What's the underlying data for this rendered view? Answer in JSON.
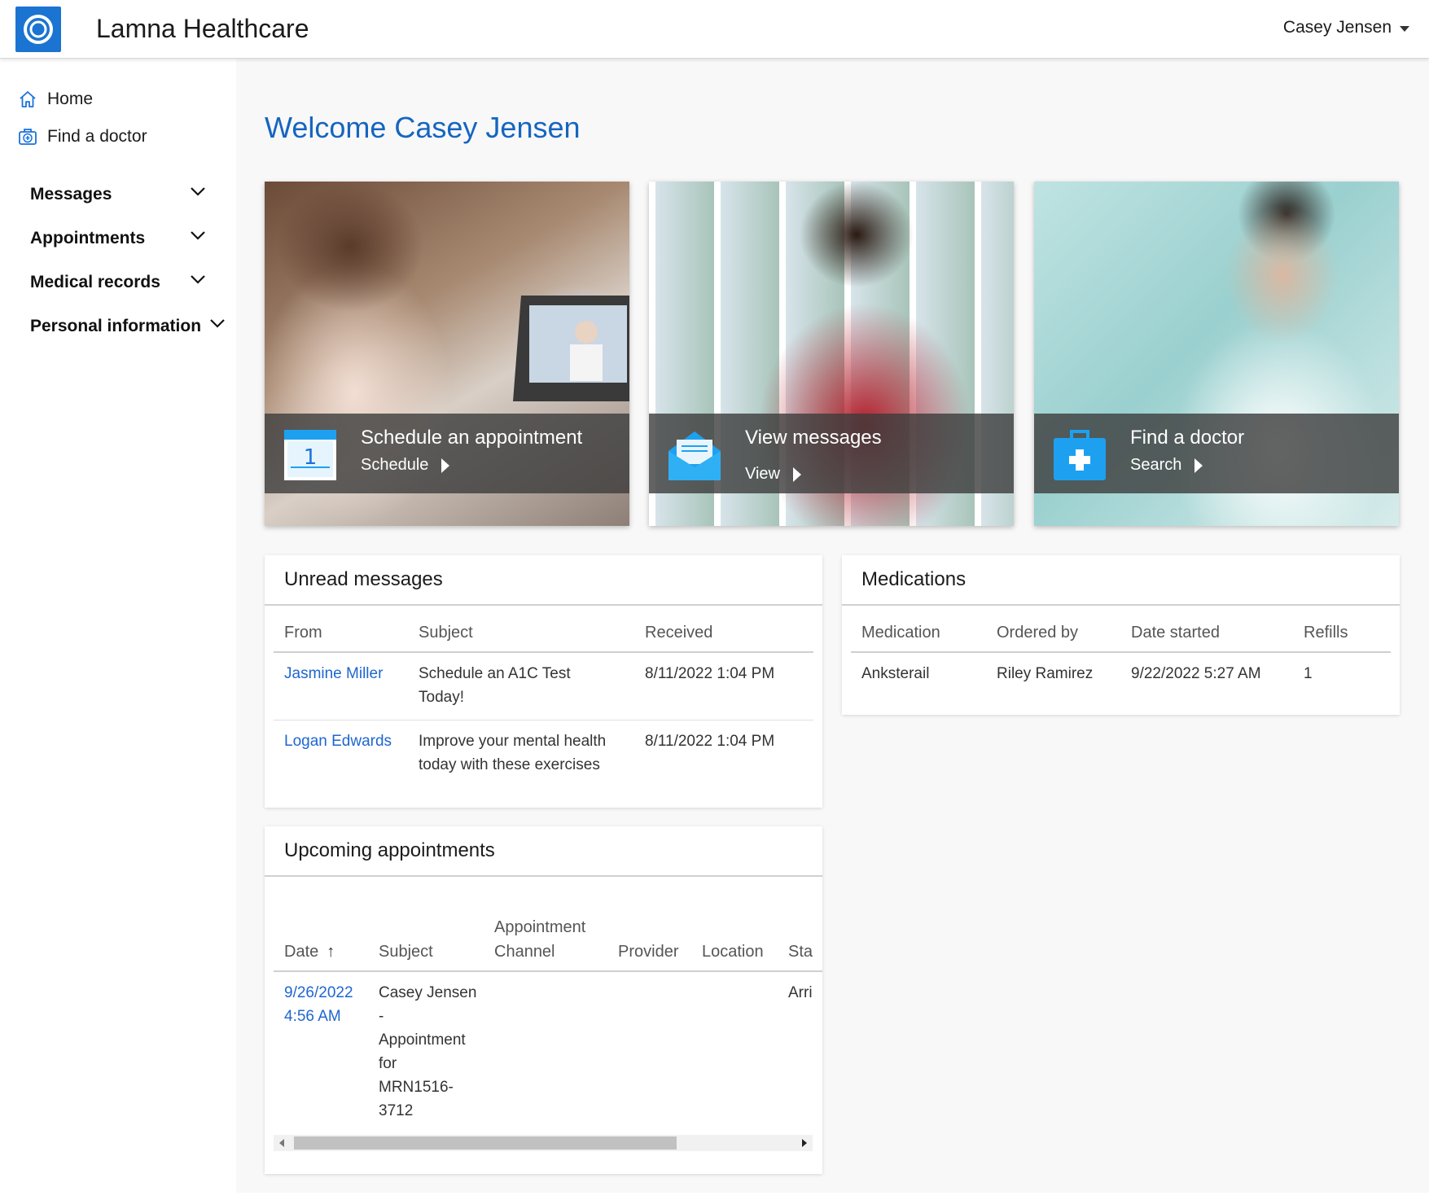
{
  "header": {
    "app_name": "Lamna Healthcare",
    "user_name": "Casey Jensen"
  },
  "sidebar": {
    "links": [
      {
        "label": "Home",
        "icon": "home-icon"
      },
      {
        "label": "Find a doctor",
        "icon": "medical-kit-icon"
      }
    ],
    "groups": [
      {
        "label": "Messages"
      },
      {
        "label": "Appointments"
      },
      {
        "label": "Medical records"
      },
      {
        "label": "Personal information"
      }
    ]
  },
  "main": {
    "welcome": "Welcome Casey Jensen",
    "tiles": [
      {
        "title": "Schedule an appointment",
        "link": "Schedule",
        "icon": "calendar-icon"
      },
      {
        "title": "View messages",
        "link": "View",
        "icon": "envelope-icon"
      },
      {
        "title": "Find a doctor",
        "link": "Search",
        "icon": "medical-kit-icon"
      }
    ]
  },
  "unread_messages": {
    "title": "Unread messages",
    "columns": [
      "From",
      "Subject",
      "Received"
    ],
    "rows": [
      {
        "from": "Jasmine Miller",
        "subject_line1": "Schedule an A1C Test",
        "subject_line2": "Today!",
        "received": "8/11/2022 1:04 PM"
      },
      {
        "from": "Logan Edwards",
        "subject_line1": "Improve your mental health",
        "subject_line2": "today with these exercises",
        "received": "8/11/2022 1:04 PM"
      }
    ]
  },
  "medications": {
    "title": "Medications",
    "columns": [
      "Medication",
      "Ordered by",
      "Date started",
      "Refills"
    ],
    "rows": [
      {
        "medication": "Anksterail",
        "ordered_by": "Riley Ramirez",
        "date_started": "9/22/2022 5:27 AM",
        "refills": "1"
      }
    ]
  },
  "appointments": {
    "title": "Upcoming appointments",
    "columns": {
      "date": "Date",
      "subject": "Subject",
      "channel_line1": "Appointment",
      "channel_line2": "Channel",
      "provider": "Provider",
      "location": "Location",
      "status": "Sta"
    },
    "sort_indicator": "↑",
    "rows": [
      {
        "date_line1": "9/26/2022",
        "date_line2": "4:56 AM",
        "subject_lines": [
          "Casey Jensen",
          "-",
          "Appointment",
          "for",
          "MRN1516-",
          "3712"
        ],
        "status": "Arri"
      }
    ]
  }
}
